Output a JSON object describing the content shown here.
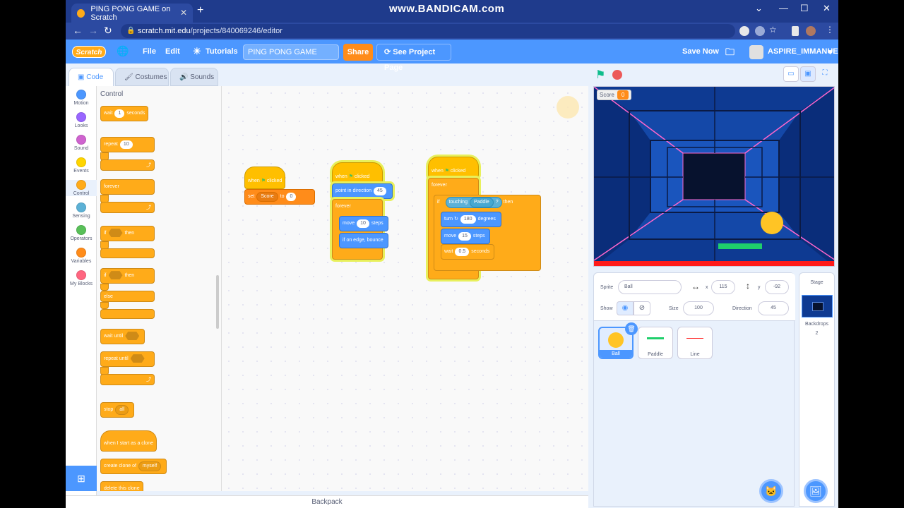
{
  "browser": {
    "tab_title": "PING PONG GAME on Scratch",
    "watermark": "www.BANDICAM.com",
    "url_host": "scratch.mit.edu",
    "url_path": "/projects/840069246/editor"
  },
  "menu": {
    "logo": "Scratch",
    "file": "File",
    "edit": "Edit",
    "tutorials": "Tutorials",
    "project_title": "PING PONG GAME",
    "share": "Share",
    "see_project": "See Project Page",
    "save_now": "Save Now",
    "username": "ASPIRE_IMMANUEL"
  },
  "tabs": {
    "code": "Code",
    "costumes": "Costumes",
    "sounds": "Sounds"
  },
  "categories": [
    {
      "label": "Motion",
      "color": "#4c97ff"
    },
    {
      "label": "Looks",
      "color": "#9966ff"
    },
    {
      "label": "Sound",
      "color": "#cf63cf"
    },
    {
      "label": "Events",
      "color": "#ffd500"
    },
    {
      "label": "Control",
      "color": "#ffab19"
    },
    {
      "label": "Sensing",
      "color": "#5cb1d6"
    },
    {
      "label": "Operators",
      "color": "#59c059"
    },
    {
      "label": "Variables",
      "color": "#ff8c1a"
    },
    {
      "label": "My Blocks",
      "color": "#ff6680"
    }
  ],
  "palette": {
    "title": "Control",
    "wait": "wait",
    "wait_val": "1",
    "seconds": "seconds",
    "repeat": "repeat",
    "repeat_val": "10",
    "forever": "forever",
    "if": "if",
    "then": "then",
    "else": "else",
    "wait_until": "wait until",
    "repeat_until": "repeat until",
    "stop": "stop",
    "stop_val": "all",
    "clone_start": "when I start as a clone",
    "create_clone": "create clone of",
    "create_clone_val": "myself",
    "delete_clone": "delete this clone"
  },
  "scripts": {
    "when": "when",
    "clicked": "clicked",
    "set": "set",
    "score_var": "Score",
    "to": "to",
    "set_val": "0",
    "point": "point in direction",
    "point_val": "45",
    "forever": "forever",
    "move": "move",
    "move_val1": "10",
    "steps": "steps",
    "bounce": "if on edge, bounce",
    "if": "if",
    "touching": "touching",
    "touching_val": "Paddle",
    "q": "?",
    "then": "then",
    "turn": "turn",
    "turn_val": "180",
    "degrees": "degrees",
    "move_val2": "15",
    "wait": "wait",
    "wait_val": "0.5",
    "seconds": "seconds"
  },
  "backpack": "Backpack",
  "stage": {
    "score_label": "Score",
    "score_value": "0"
  },
  "sprite": {
    "sprite_label": "Sprite",
    "sprite_name": "Ball",
    "x_label": "x",
    "x_val": "115",
    "y_label": "y",
    "y_val": "-92",
    "show_label": "Show",
    "size_label": "Size",
    "size_val": "100",
    "direction_label": "Direction",
    "direction_val": "45",
    "sprites": [
      "Ball",
      "Paddle",
      "Line"
    ]
  },
  "stage_panel": {
    "title": "Stage",
    "backdrops_label": "Backdrops",
    "backdrops_count": "2"
  }
}
